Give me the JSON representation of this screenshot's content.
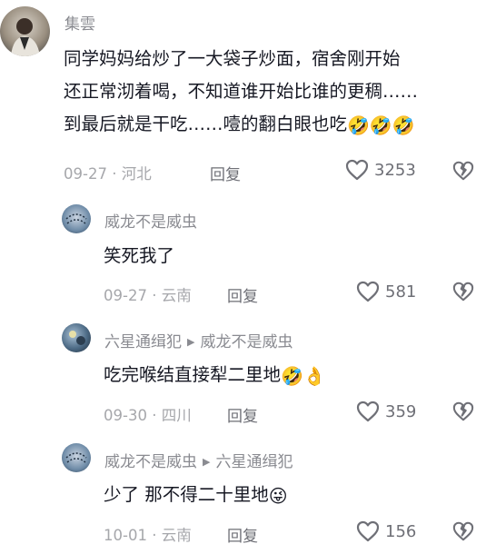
{
  "comments": [
    {
      "author": "集雲",
      "text_lines": [
        "同学妈妈给炒了一大袋子炒面，宿舍刚开始",
        "还正常沏着喝，不知道谁开始比谁的更稠……",
        "到最后就是干吃……噎的翻白眼也吃"
      ],
      "trailing_emoji": "🤣🤣🤣",
      "date": "09-27",
      "location": "河北",
      "reply_label": "回复",
      "like_count": "3253"
    }
  ],
  "replies": [
    {
      "author": "威龙不是威虫",
      "reply_to": "",
      "text": "笑死我了",
      "emoji": "",
      "date": "09-27",
      "location": "云南",
      "reply_label": "回复",
      "like_count": "581"
    },
    {
      "author": "六星通缉犯",
      "reply_to": "威龙不是威虫",
      "text": "吃完喉结直接犁二里地",
      "emoji": "🤣👌",
      "date": "09-30",
      "location": "四川",
      "reply_label": "回复",
      "like_count": "359"
    },
    {
      "author": "威龙不是威虫",
      "reply_to": "六星通缉犯",
      "text": "少了 那不得二十里地",
      "emoji": "😜",
      "date": "10-01",
      "location": "云南",
      "reply_label": "回复",
      "like_count": "156"
    }
  ],
  "meta_separator": " · ",
  "icons": {
    "like": "heart-outline-icon",
    "dislike": "broken-heart-icon",
    "reply_arrow": "triangle-right-icon"
  },
  "colors": {
    "text": "#161823",
    "secondary": "#8a8b91",
    "meta": "#a6a7ab",
    "icon": "#6e6f76"
  }
}
